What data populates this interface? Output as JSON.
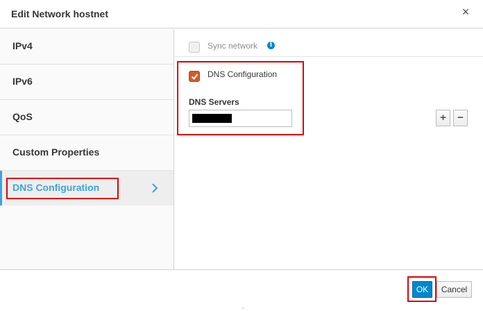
{
  "dialog": {
    "title": "Edit Network hostnet",
    "close_glyph": "×",
    "close_icon": "close-icon"
  },
  "sidebar": {
    "items": [
      {
        "label": "IPv4",
        "active": false
      },
      {
        "label": "IPv6",
        "active": false
      },
      {
        "label": "QoS",
        "active": false
      },
      {
        "label": "Custom Properties",
        "active": false
      },
      {
        "label": "DNS Configuration",
        "active": true
      }
    ],
    "chevron_icon": "chevron-right-icon"
  },
  "main": {
    "sync_network": {
      "label": "Sync network",
      "checked": false,
      "disabled": true,
      "info_glyph": "i",
      "info_icon": "info-icon"
    },
    "dns_configuration": {
      "label": "DNS Configuration",
      "checked": true
    },
    "dns_servers": {
      "label": "DNS Servers",
      "value_redacted": true
    },
    "add_glyph": "+",
    "remove_glyph": "−"
  },
  "footer": {
    "ok_label": "OK",
    "cancel_label": "Cancel"
  },
  "colors": {
    "accent": "#39a5dc",
    "primary_button": "#0088ce",
    "checkbox_checked": "#d15b2b",
    "highlight": "#e00000"
  }
}
